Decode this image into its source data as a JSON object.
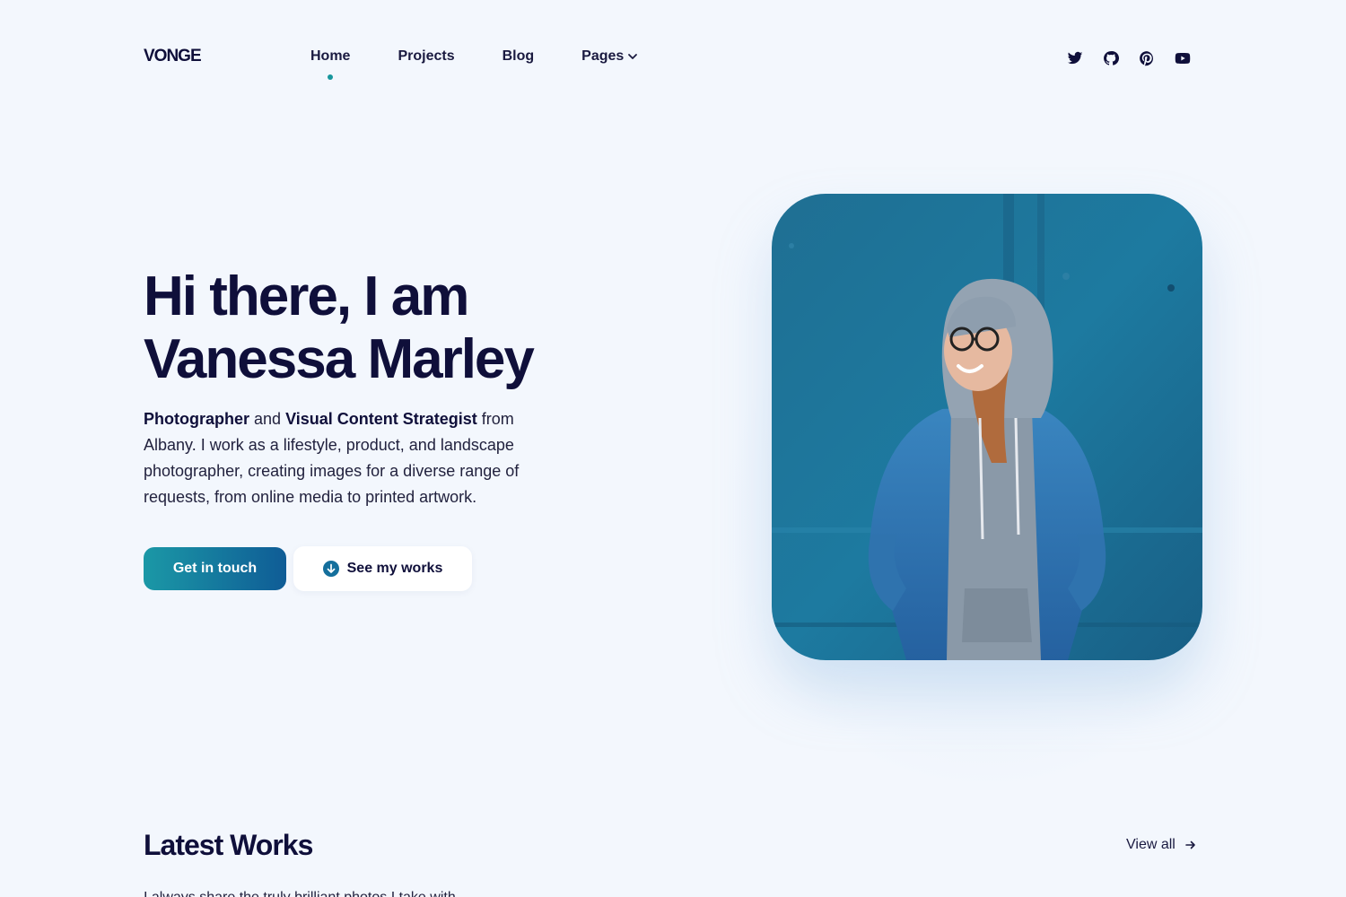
{
  "header": {
    "logo": "VONGE",
    "nav": [
      {
        "label": "Home",
        "active": true
      },
      {
        "label": "Projects",
        "active": false
      },
      {
        "label": "Blog",
        "active": false
      },
      {
        "label": "Pages",
        "active": false,
        "dropdown": true
      }
    ],
    "socials": [
      "twitter-icon",
      "github-icon",
      "pinterest-icon",
      "youtube-icon"
    ]
  },
  "hero": {
    "title_line1": "Hi there, I am",
    "title_line2": "Vanessa Marley",
    "desc_role1": "Photographer",
    "desc_and": " and ",
    "desc_role2": "Visual Content Strategist",
    "desc_rest": " from Albany. I work as a lifestyle, product, and landscape photographer, creating images for a diverse range of requests, from online media to printed artwork.",
    "primary_button": "Get in touch",
    "secondary_button": "See my works",
    "photo_alt": "portrait-photo"
  },
  "latest": {
    "title": "Latest Works",
    "view_all": "View all",
    "intro_partial": "I always share the truly brilliant photos I take with"
  },
  "colors": {
    "background": "#f3f7fd",
    "text": "#0f0f3a",
    "accent": "#17969c",
    "button_gradient_start": "#1b98a6",
    "button_gradient_end": "#0f5c96"
  }
}
